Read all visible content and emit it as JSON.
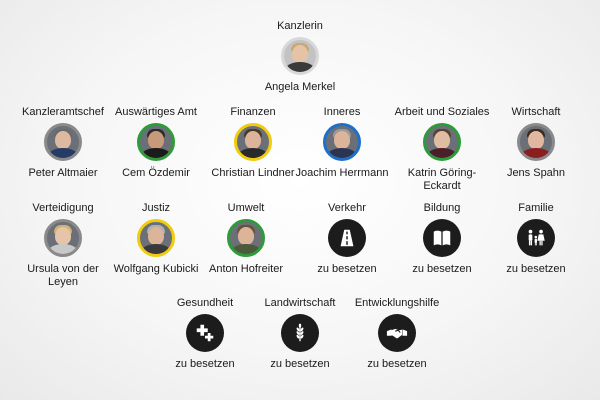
{
  "chancellor": {
    "role": "Kanzlerin",
    "name": "Angela Merkel",
    "icon": "portrait-icon"
  },
  "row1": [
    {
      "role": "Kanzleramtschef",
      "name": "Peter Altmaier",
      "party_color": "#909090"
    },
    {
      "role": "Auswärtiges Amt",
      "name": "Cem Özdemir",
      "party_color": "#2e9a3a"
    },
    {
      "role": "Finanzen",
      "name": "Christian Lindner",
      "party_color": "#f0cc10"
    },
    {
      "role": "Inneres",
      "name": "Joachim Herrmann",
      "party_color": "#1f6ec8"
    },
    {
      "role": "Arbeit und Soziales",
      "name": "Katrin Göring-Eckardt",
      "party_color": "#2e9a3a"
    },
    {
      "role": "Wirtschaft",
      "name": "Jens Spahn",
      "party_color": "#909090"
    }
  ],
  "row2": [
    {
      "role": "Verteidigung",
      "name": "Ursula von der Leyen",
      "party_color": "#8a8a8a"
    },
    {
      "role": "Justiz",
      "name": "Wolfgang Kubicki",
      "party_color": "#f0cc10"
    },
    {
      "role": "Umwelt",
      "name": "Anton Hofreiter",
      "party_color": "#2e9a3a"
    },
    {
      "role": "Verkehr",
      "name": "zu besetzen",
      "icon": "road-icon"
    },
    {
      "role": "Bildung",
      "name": "zu besetzen",
      "icon": "book-icon"
    },
    {
      "role": "Familie",
      "name": "zu besetzen",
      "icon": "family-icon"
    }
  ],
  "row3": [
    {
      "role": "Gesundheit",
      "name": "zu besetzen",
      "icon": "health-cross-icon"
    },
    {
      "role": "Landwirtschaft",
      "name": "zu besetzen",
      "icon": "wheat-icon"
    },
    {
      "role": "Entwicklungshilfe",
      "name": "zu besetzen",
      "icon": "handshake-icon"
    }
  ]
}
